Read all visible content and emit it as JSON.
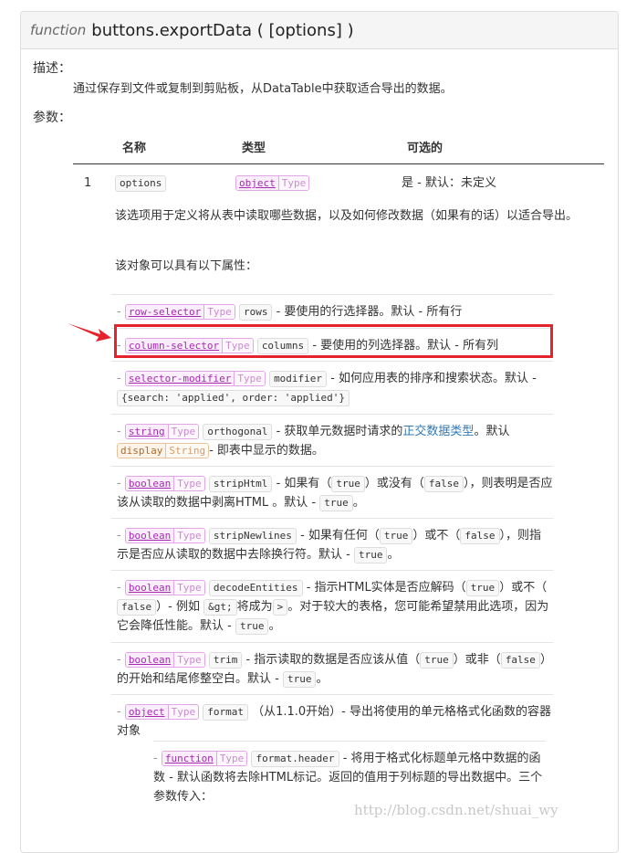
{
  "header": {
    "keyword": "function",
    "signature": "buttons.exportData ( [options] )"
  },
  "labels": {
    "desc": "描述：",
    "params": "参数："
  },
  "description": "通过保存到文件或复制到剪贴板，从DataTable中获取适合导出的数据。",
  "table": {
    "headers": [
      "名称",
      "类型",
      "可选的"
    ],
    "row": {
      "index": "1",
      "name": "options",
      "type": "object",
      "type_label": "Type",
      "optional": "是 - 默认：未定义",
      "note1": "该选项用于定义将从表中读取哪些数据，以及如何修改数据（如果有的话）以适合导出。",
      "note2": "该对象可以具有以下属性："
    }
  },
  "properties": [
    {
      "type": "row-selector",
      "name": "rows",
      "desc": "- 要使用的行选择器。默认 - 所有行"
    },
    {
      "type": "column-selector",
      "name": "columns",
      "desc": "- 要使用的列选择器。默认 - 所有列"
    },
    {
      "type": "selector-modifier",
      "name": "modifier",
      "desc": "- 如何应用表的排序和搜索状态。默认 -",
      "default_code": "{search: 'applied', order: 'applied'}"
    },
    {
      "type": "string",
      "name": "orthogonal",
      "desc_a": "- 获取单元数据时请求的",
      "link": "正交数据类型",
      "desc_b": "。默认",
      "default_code": "display",
      "default_label": "String",
      "desc_c": "- 即表中显示的数据。"
    },
    {
      "type": "boolean",
      "name": "stripHtml",
      "a": "- 如果有（",
      "c1": "true",
      "b": "）或没有（",
      "c2": "false",
      "c": "），则表明是否应该从读取的数据中剥离HTML 。默认 -",
      "c3": "true",
      "d": "。"
    },
    {
      "type": "boolean",
      "name": "stripNewlines",
      "a": "- 如果有任何（",
      "c1": "true",
      "b": "）或不（",
      "c2": "false",
      "c": "），则指示是否应从读取的数据中去除换行符。默认 -",
      "c3": "true",
      "d": "。"
    },
    {
      "type": "boolean",
      "name": "decodeEntities",
      "a": "- 指示HTML实体是否应解码（",
      "c1": "true",
      "b": "）或不（",
      "c2": "false",
      "c": "）- 例如",
      "c3": "&gt;",
      "c_mid": "将成为",
      "c4": ">",
      "d": "。对于较大的表格，您可能希望禁用此选项，因为它会降低性能。默认 -",
      "c5": "true",
      "e": "。"
    },
    {
      "type": "boolean",
      "name": "trim",
      "a": "- 指示读取的数据是否应该从值（",
      "c1": "true",
      "b": "）或非（",
      "c2": "false",
      "c": "）的开始和结尾修整空白。默认 -",
      "c3": "true",
      "d": "。"
    },
    {
      "type": "object",
      "name": "format",
      "desc": "（从1.1.0开始）- 导出将使用的单元格格式化函数的容器对象"
    }
  ],
  "sub_property": {
    "type": "function",
    "name": "format.header",
    "desc": "- 将用于格式化标题单元格中数据的函数 - 默认函数将去除HTML标记。返回的值用于列标题的导出数据中。三个参数传入："
  },
  "type_label": "Type",
  "watermark": "http://blog.csdn.net/shuai_wy",
  "colors": {
    "highlight": "#e5232c",
    "type_text": "#a52ab0",
    "link": "#337ab7"
  }
}
